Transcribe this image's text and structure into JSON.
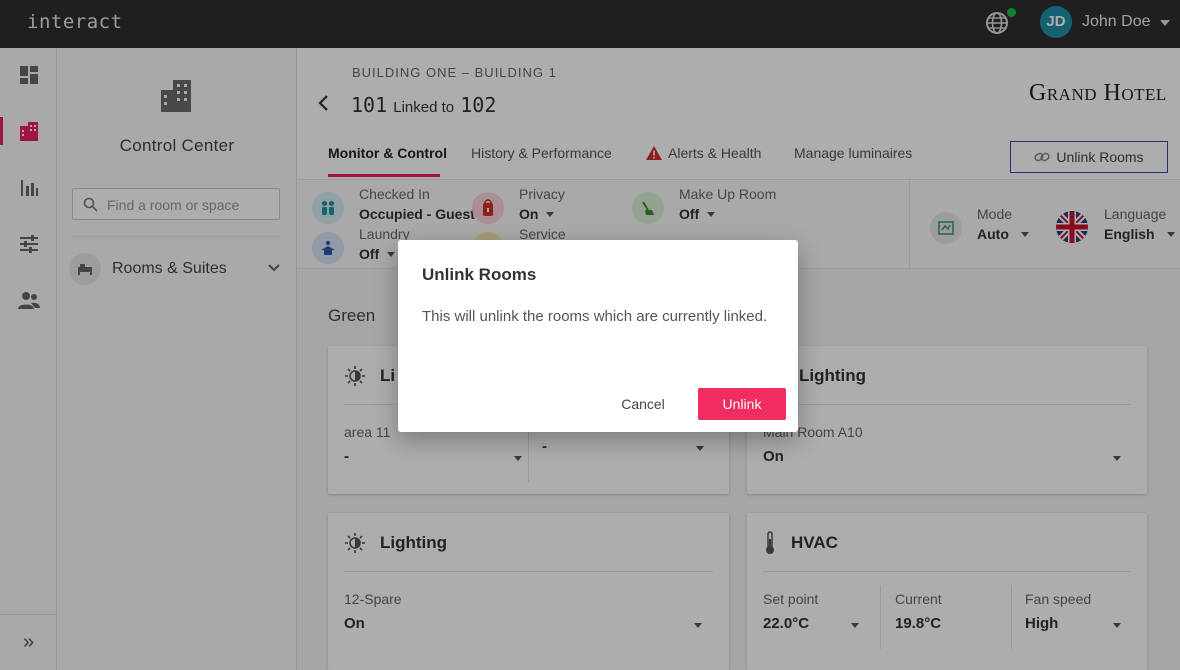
{
  "app": {
    "logo": "interact"
  },
  "user": {
    "initials": "JD",
    "name": "John Doe"
  },
  "sidebar": {
    "title": "Control Center",
    "search_placeholder": "Find a room or space",
    "group_label": "Rooms & Suites"
  },
  "header": {
    "breadcrumb": "BUILDING ONE – BUILDING 1",
    "room": "101",
    "linked_text": "Linked to",
    "linked_room": "102",
    "brand": "Grand Hotel",
    "unlink_button": "Unlink Rooms"
  },
  "tabs": [
    {
      "label": "Monitor & Control"
    },
    {
      "label": "History & Performance"
    },
    {
      "label": "Alerts & Health"
    },
    {
      "label": "Manage luminaires"
    }
  ],
  "status": {
    "checked_in": {
      "label": "Checked In",
      "value": "Occupied - Guest"
    },
    "laundry": {
      "label": "Laundry",
      "value": "Off"
    },
    "privacy": {
      "label": "Privacy",
      "value": "On"
    },
    "service": {
      "label": "Service"
    },
    "makeup": {
      "label": "Make Up Room",
      "value": "Off"
    },
    "mode": {
      "label": "Mode",
      "value": "Auto"
    },
    "language": {
      "label": "Language",
      "value": "English"
    }
  },
  "section": {
    "label": "Green"
  },
  "cards": {
    "lighting1": {
      "title": "Li",
      "area_label": "area 11",
      "area_value": "-",
      "second_value": "-"
    },
    "lighting2": {
      "title": "Lighting",
      "area_label": "Main Room A10",
      "area_value": "On"
    },
    "lighting3": {
      "title": "Lighting",
      "area_label": "12-Spare",
      "area_value": "On"
    },
    "hvac": {
      "title": "HVAC",
      "setpoint_label": "Set point",
      "setpoint_value": "22.0°C",
      "current_label": "Current",
      "current_value": "19.8°C",
      "fan_label": "Fan speed",
      "fan_value": "High"
    }
  },
  "modal": {
    "title": "Unlink Rooms",
    "body": "This will unlink the rooms which are currently linked.",
    "cancel": "Cancel",
    "confirm": "Unlink"
  },
  "colors": {
    "accent": "#e91e63",
    "confirm": "#f02d5e",
    "topbar": "#2e2e2e",
    "online": "#19c34a",
    "avatar": "#1f8fa6"
  }
}
